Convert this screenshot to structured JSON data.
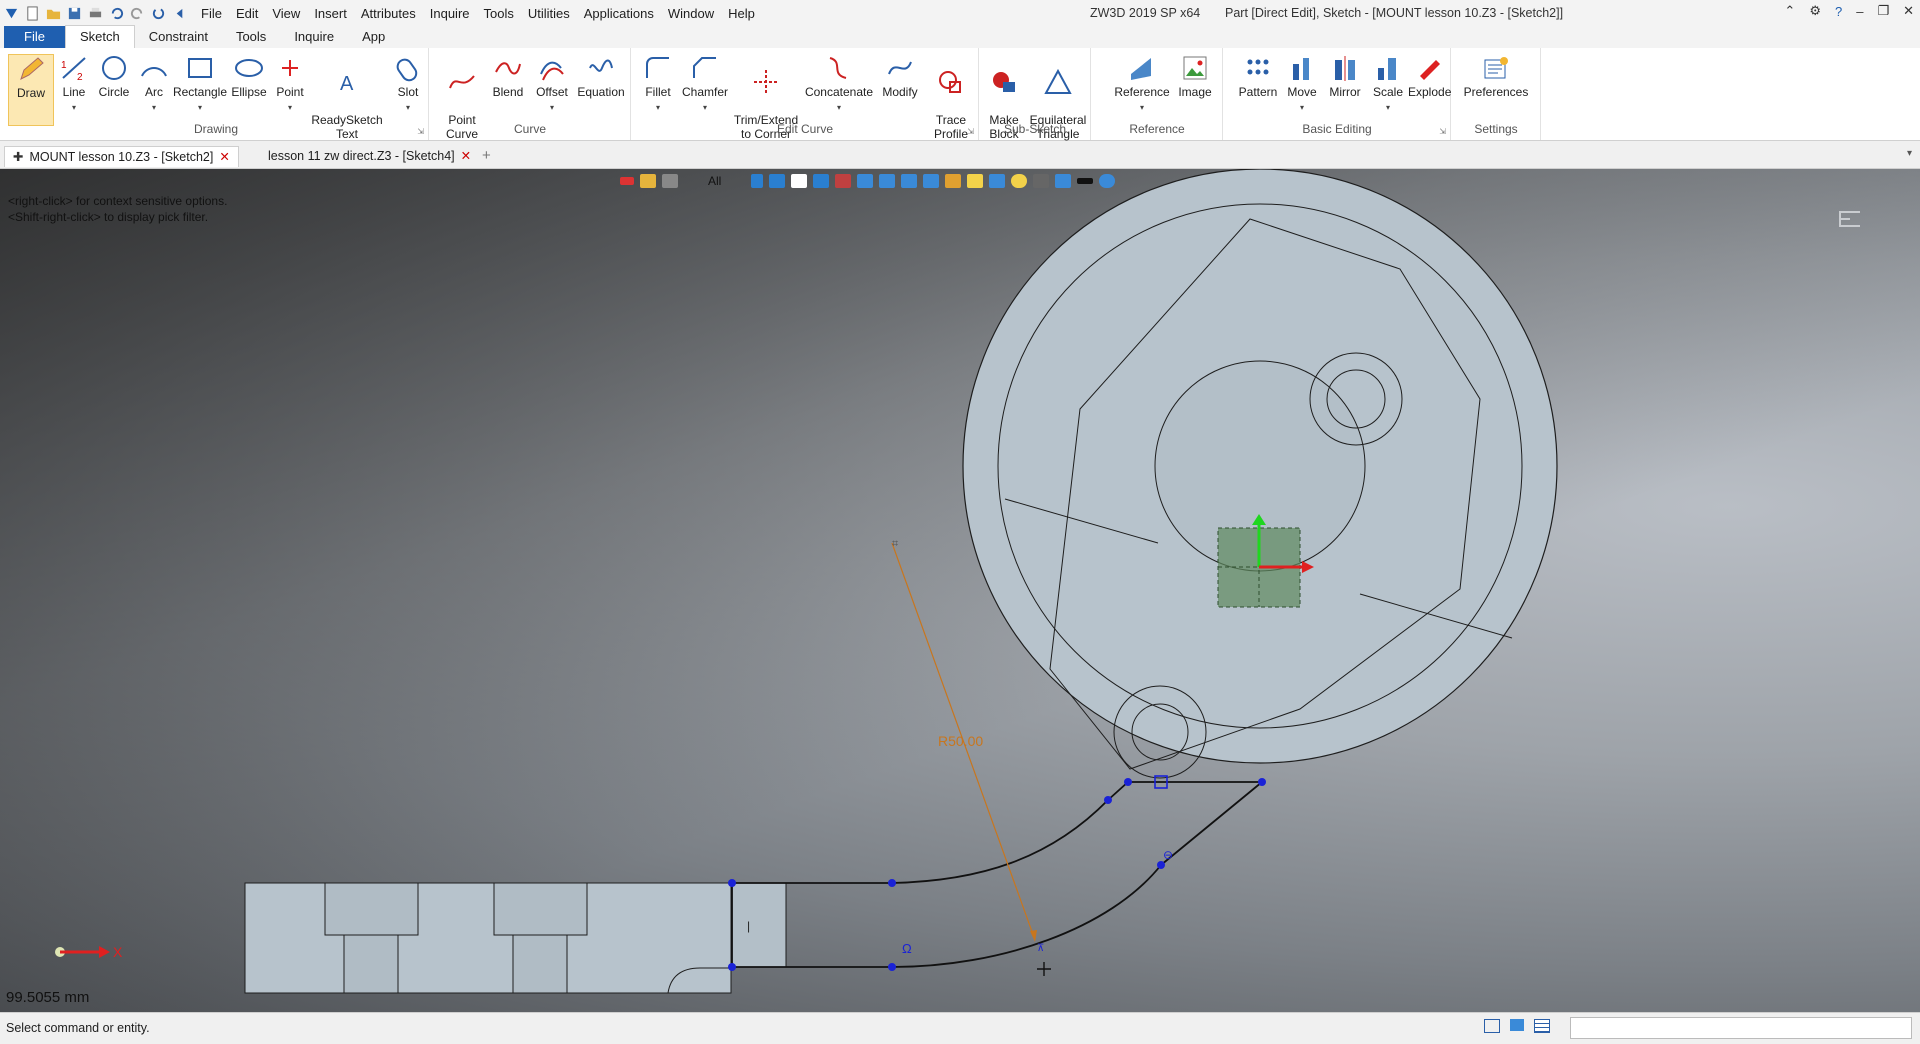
{
  "app": {
    "product": "ZW3D 2019 SP x64",
    "document_title": "Part [Direct Edit],  Sketch - [MOUNT lesson 10.Z3 - [Sketch2]]"
  },
  "menus": [
    "File",
    "Edit",
    "View",
    "Insert",
    "Attributes",
    "Inquire",
    "Tools",
    "Utilities",
    "Applications",
    "Window",
    "Help"
  ],
  "ribbon_tabs": [
    "File",
    "Sketch",
    "Constraint",
    "Tools",
    "Inquire",
    "App"
  ],
  "ribbon_active_tab": "Sketch",
  "ribbon": {
    "drawing": {
      "label": "Drawing",
      "buttons": [
        "Draw",
        "Line",
        "Circle",
        "Arc",
        "Rectangle",
        "Ellipse",
        "Point",
        "ReadySketch\nText",
        "Slot"
      ]
    },
    "curve": {
      "label": "Curve",
      "buttons": [
        "Point\nCurve",
        "Blend",
        "Offset",
        "Equation"
      ]
    },
    "edit_curve": {
      "label": "Edit Curve",
      "buttons": [
        "Fillet",
        "Chamfer",
        "Trim/Extend\nto Corner",
        "Concatenate",
        "Modify",
        "Trace\nProfile"
      ]
    },
    "sub_sketch": {
      "label": "Sub-Sketch",
      "buttons": [
        "Make\nBlock",
        "Equilateral\nTriangle"
      ]
    },
    "reference": {
      "label": "Reference",
      "buttons": [
        "Reference",
        "Image"
      ]
    },
    "basic_editing": {
      "label": "Basic Editing",
      "buttons": [
        "Pattern",
        "Move",
        "Mirror",
        "Scale",
        "Explode"
      ]
    },
    "settings": {
      "label": "Settings",
      "buttons": [
        "Preferences"
      ]
    }
  },
  "doc_tabs": [
    {
      "label": "MOUNT lesson 10.Z3 - [Sketch2]",
      "active": true
    },
    {
      "label": "lesson 11 zw direct.Z3 - [Sketch4]",
      "active": false
    }
  ],
  "viewport": {
    "hint_line1": "<right-click> for context sensitive options.",
    "hint_line2": "<Shift-right-click> to display pick filter.",
    "filter_label": "All",
    "dimension_label": "R50.00",
    "axis_label": "X",
    "readout": "99.5055 mm"
  },
  "status": {
    "message": "Select command or entity."
  },
  "colors": {
    "accent": "#1f5fb0",
    "dimension": "#c8761e",
    "sketch_point": "#1a22d6",
    "part_fill": "#b7c3cc"
  }
}
